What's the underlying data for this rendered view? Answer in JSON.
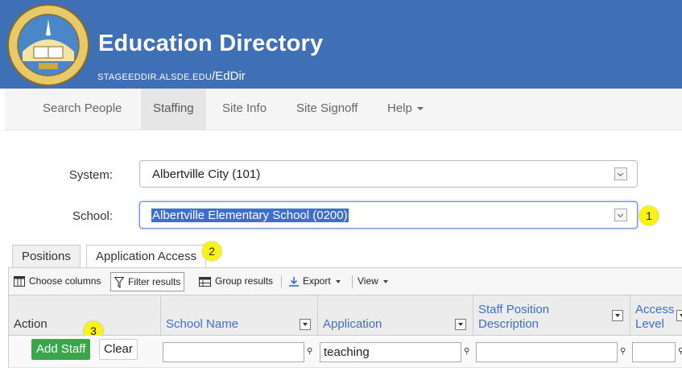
{
  "header": {
    "seal_text_top": "ALABAMA",
    "seal_text_ring": "STATE DEPARTMENT OF EDUCATION",
    "seal_year": "1854",
    "title": "Education Directory",
    "subtitle_domain": "stageeddir.alsde.edu",
    "subtitle_path": "/EdDir",
    "brand_color": "#3f6fb4"
  },
  "nav": {
    "items": [
      {
        "label": "Search People"
      },
      {
        "label": "Staffing"
      },
      {
        "label": "Site Info"
      },
      {
        "label": "Site Signoff"
      },
      {
        "label": "Help"
      }
    ],
    "active": "Staffing"
  },
  "form": {
    "system_label": "System:",
    "system_value": "Albertville City (101)",
    "school_label": "School:",
    "school_value": "Albertville Elementary School (0200)"
  },
  "callouts": [
    "1",
    "2",
    "3"
  ],
  "tabs": [
    {
      "label": "Positions"
    },
    {
      "label": "Application Access"
    }
  ],
  "toolbar": {
    "choose_columns": "Choose columns",
    "filter_results": "Filter results",
    "group_results": "Group results",
    "export": "Export",
    "view": "View"
  },
  "grid": {
    "columns": [
      {
        "label": "Action"
      },
      {
        "label": "School Name"
      },
      {
        "label": "Application"
      },
      {
        "label": "Staff Position Description"
      },
      {
        "label": "Access Level"
      }
    ],
    "filters": {
      "school_name": "",
      "application": "teaching",
      "staff_position": "",
      "access_level": ""
    },
    "add_staff_label": "Add Staff",
    "clear_label": "Clear",
    "accent_color": "#3b6fc9",
    "add_button_color": "#3aa64a"
  }
}
